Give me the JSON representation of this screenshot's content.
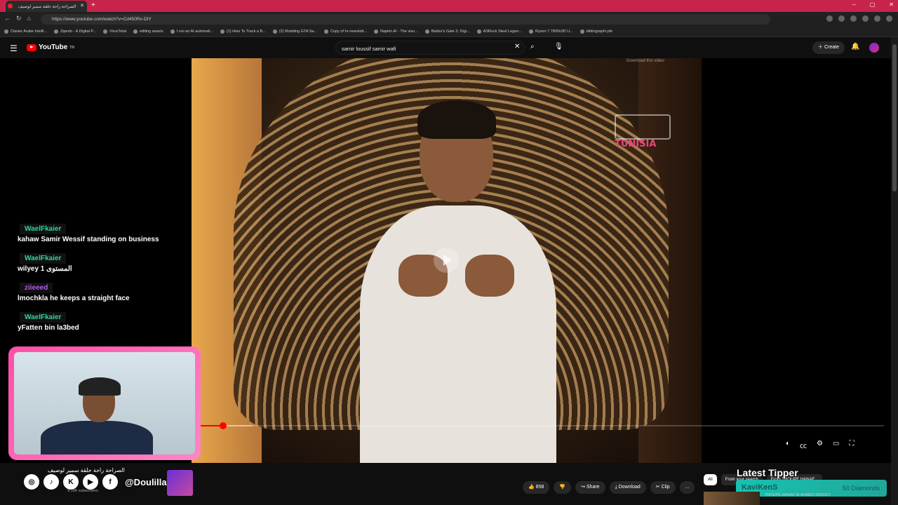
{
  "browser": {
    "tab_title": "الصراحة راحة حلقة سمير لوصيف",
    "new_tab": "+",
    "window_controls": [
      "–",
      "▢",
      "✕"
    ],
    "url": "https://www.youtube.com/watch?v=Cd450Rx-DIY",
    "bookmarks": [
      "Clavier Arabe Intelli...",
      "Ziperto - A Digital P...",
      "VirusTotal",
      "editing assets",
      "I run an AI automati...",
      "(1) How To Track a B...",
      "(2) Modding GTA Sa...",
      "Copy of hr-newslett...",
      "Napkin AI - The visu...",
      "Baldur's Gate 3: Digi...",
      "ASRock Steel Legen...",
      "Ryzen 7 7800x3D U...",
      "bibliographi pfe"
    ]
  },
  "youtube": {
    "logo_text": "YouTube",
    "logo_suffix": "TN",
    "search_query": "samir loussif samir wafi",
    "create_label": "Create"
  },
  "video": {
    "watermark": "TUNISIA",
    "download_tip": "Download this video",
    "progress_fraction": 0.034,
    "loaded_fraction": 0.077
  },
  "chat": [
    {
      "user": "WaelFkaier",
      "user_color": "#34d399",
      "text": "kahaw Samir Wessif standing on business"
    },
    {
      "user": "WaelFkaier",
      "user_color": "#34d399",
      "text": "wilyey 1 المستوى"
    },
    {
      "user": "ziieeed",
      "user_color": "#b05cf0",
      "text": "lmochkla he keeps a straight face"
    },
    {
      "user": "WaelFkaier",
      "user_color": "#34d399",
      "text": "yFatten bin la3bed"
    }
  ],
  "below": {
    "video_title": "الصراحة راحة حلقة سمير لوصيف",
    "subscribers": "9.19K subscribers",
    "social_handle": "@Doulilla",
    "like_count": "858",
    "share": "Share",
    "download": "Download",
    "clip": "Clip",
    "more": "...",
    "chips": [
      "All",
      "From your search",
      "From TROUPE HANAF..."
    ],
    "related_text": "TROUPE HANAF ALAHMED DEBOCI"
  },
  "overlay": {
    "latest_tipper_label": "Latest Tipper",
    "tipper_name": "KaviKenS",
    "tipper_amount": "50 Diamonds"
  }
}
